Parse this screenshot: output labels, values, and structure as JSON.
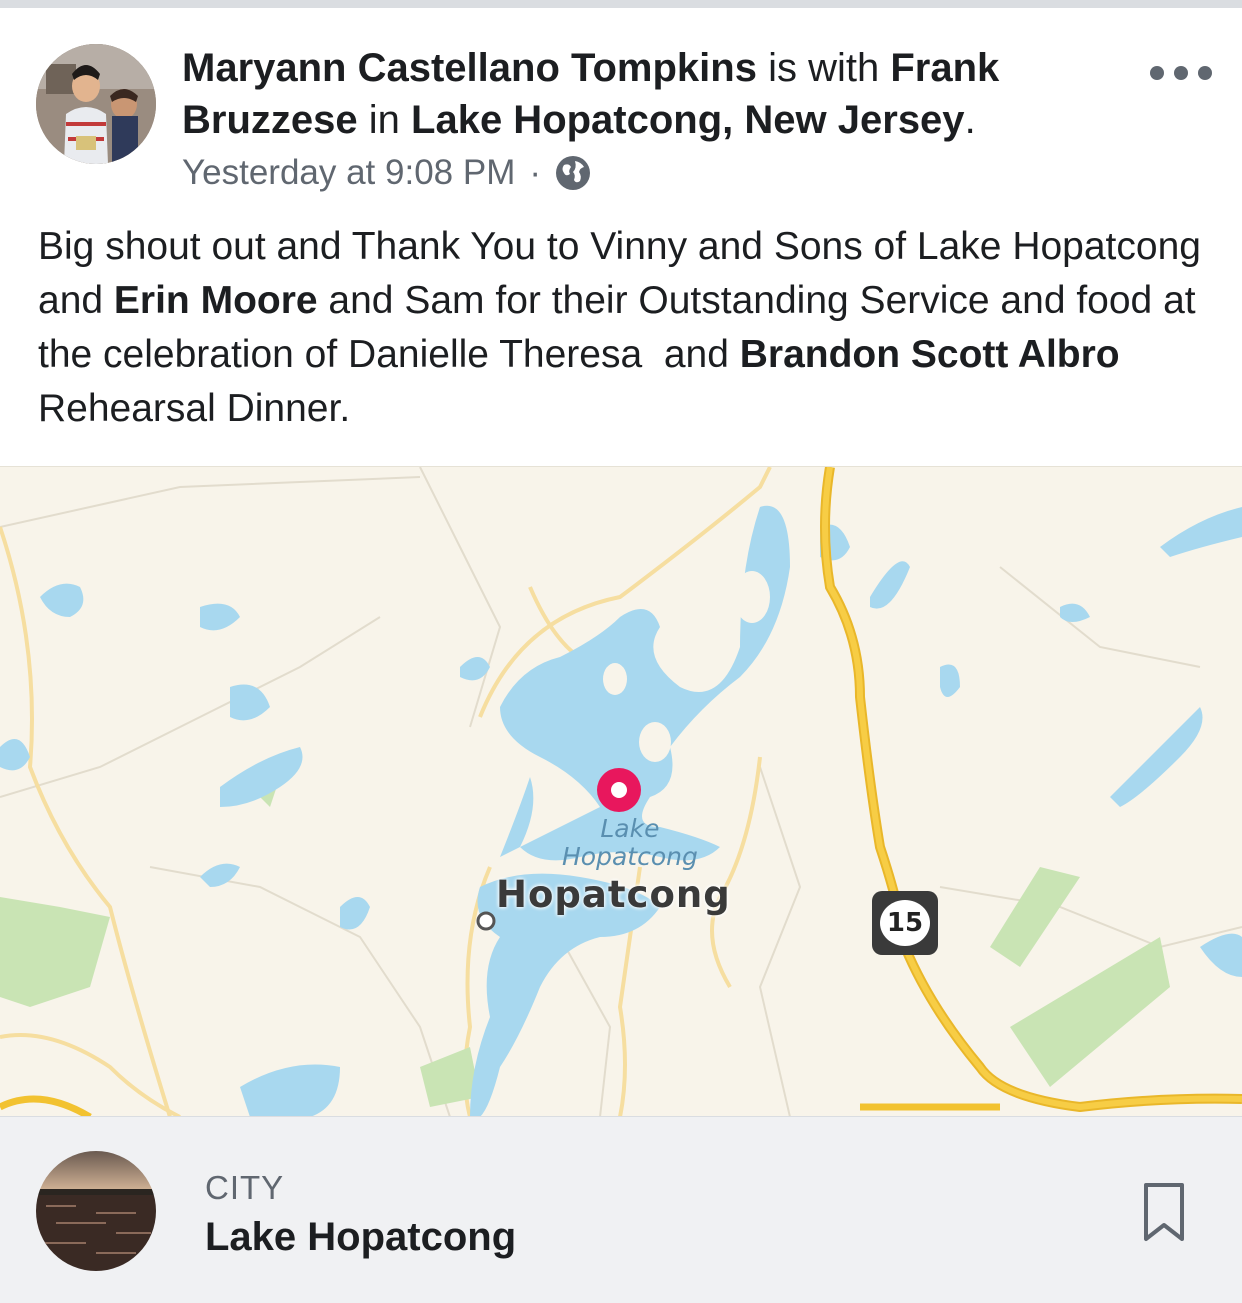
{
  "post": {
    "author": "Maryann Castellano Tompkins",
    "with_word": "is with",
    "tagged_person": "Frank Bruzzese",
    "in_word": "in",
    "location": "Lake Hopatcong, New Jersey",
    "period": ".",
    "timestamp": "Yesterday at 9:08 PM",
    "separator": "·",
    "privacy_icon": "globe-icon",
    "more_icon": "more-options-icon",
    "body": {
      "part1": "Big shout out and Thank You to Vinny and Sons of Lake Hopatcong  and ",
      "mention1": "Erin Moore",
      "part2": " and Sam for their Outstanding Service and food at the celebration of Danielle Theresa  and ",
      "mention2": "Brandon Scott Albro",
      "part3": " Rehearsal Dinner."
    }
  },
  "map": {
    "lake_label_line1": "Lake",
    "lake_label_line2": "Hopatcong",
    "town_label": "Hopatcong",
    "route_number": "15",
    "pin_color": "#e8175d",
    "water_color": "#a8d8ef",
    "road_color": "#f5c230"
  },
  "place": {
    "type": "CITY",
    "name": "Lake Hopatcong",
    "save_icon": "bookmark-icon"
  }
}
